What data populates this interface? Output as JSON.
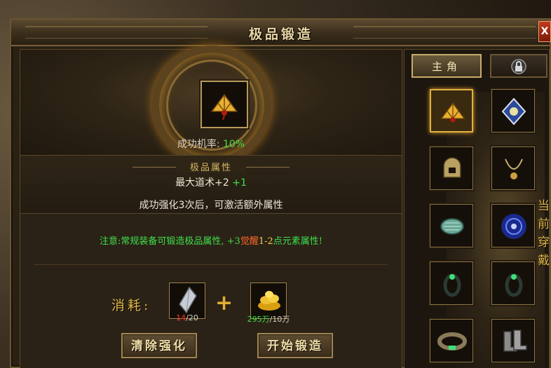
{
  "window": {
    "title": "极品锻造",
    "close_label": "X"
  },
  "forge": {
    "success_label": "成功机率: ",
    "success_value": "10%"
  },
  "attributes": {
    "title": "极品属性",
    "attr_text": "最大道术+2",
    "attr_bonus": "+1",
    "unlock_text": "成功强化3次后，可激活额外属性"
  },
  "note": {
    "prefix": "注意:常规装备可锻造极品属性, +3",
    "highlight": "觉醒",
    "middle": "1-2",
    "suffix": "点元素属性!"
  },
  "consume": {
    "label": "消耗:",
    "plus": "+",
    "material1": {
      "current": "14",
      "required": "/20",
      "icon": "crystal-icon"
    },
    "material2": {
      "current": "295万",
      "required": "/10万",
      "icon": "gold-icon"
    }
  },
  "buttons": {
    "clear": "清除强化",
    "start": "开始锻造"
  },
  "right_panel": {
    "tab_main": "主角",
    "tab_lock_icon": "lock-icon",
    "side_text": [
      "当",
      "前",
      "穿",
      "戴"
    ],
    "equipment": [
      {
        "name": "fan-weapon",
        "icon": "fan-icon",
        "selected": true
      },
      {
        "name": "medal",
        "icon": "medal-icon",
        "selected": false
      },
      {
        "name": "helmet",
        "icon": "helmet-icon",
        "selected": false
      },
      {
        "name": "necklace",
        "icon": "necklace-icon",
        "selected": false
      },
      {
        "name": "bracelet-left",
        "icon": "bracelet-icon",
        "selected": false
      },
      {
        "name": "soul-orb",
        "icon": "orb-icon",
        "selected": false
      },
      {
        "name": "ring-left",
        "icon": "ring-icon",
        "selected": false
      },
      {
        "name": "ring-right",
        "icon": "ring-icon",
        "selected": false
      },
      {
        "name": "belt",
        "icon": "belt-icon",
        "selected": false
      },
      {
        "name": "boots",
        "icon": "boots-icon",
        "selected": false
      }
    ]
  },
  "colors": {
    "accent_gold": "#e0b84a",
    "success_green": "#3ee04a",
    "warn_red": "#ff3a2a"
  }
}
